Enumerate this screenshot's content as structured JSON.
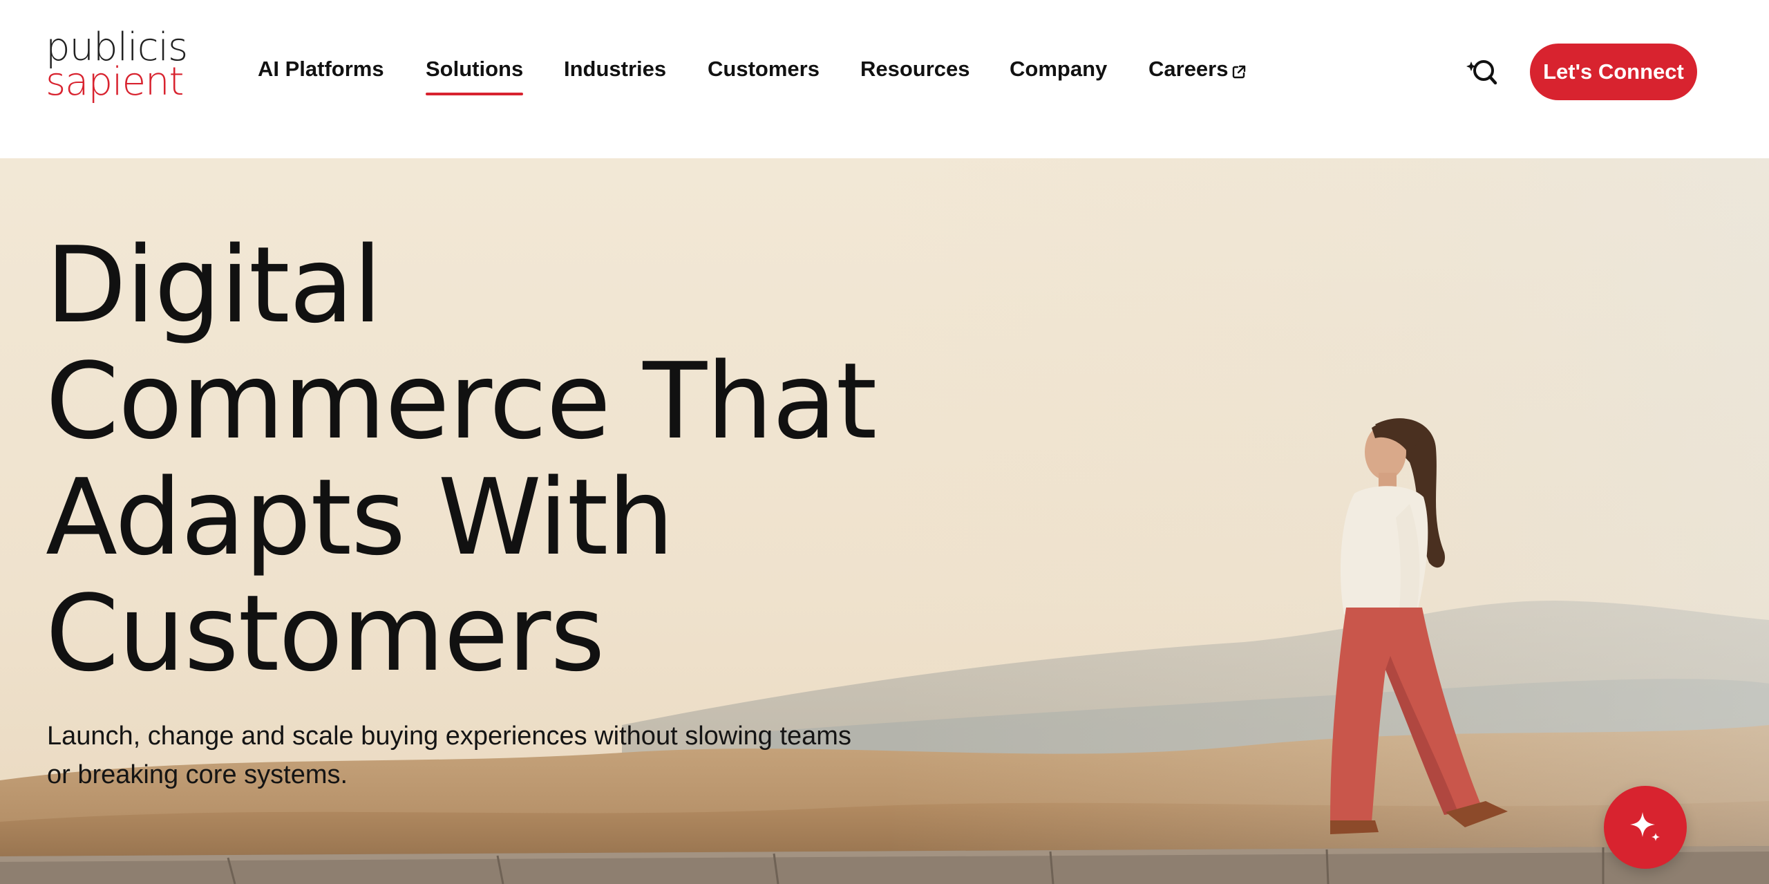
{
  "brand": {
    "logo_line1": "publicis",
    "logo_line2": "sapient",
    "accent_color": "#d8232f"
  },
  "nav": {
    "items": [
      {
        "label": "AI Platforms",
        "active": false
      },
      {
        "label": "Solutions",
        "active": true
      },
      {
        "label": "Industries",
        "active": false
      },
      {
        "label": "Customers",
        "active": false
      },
      {
        "label": "Resources",
        "active": false
      },
      {
        "label": "Company",
        "active": false
      },
      {
        "label": "Careers",
        "active": false,
        "icon": "external-link-icon"
      }
    ],
    "search_icon": "ai-search-icon",
    "cta_label": "Let's Connect"
  },
  "hero": {
    "title_lines": [
      "Digital",
      "Commerce That",
      "Adapts With",
      "Customers"
    ],
    "subtitle_line1": "Launch, change and scale buying experiences without slowing teams",
    "subtitle_line2": "or breaking core systems.",
    "image_subject": "woman-walking-desert-boardwalk",
    "fab_icon": "sparkle-icon"
  }
}
